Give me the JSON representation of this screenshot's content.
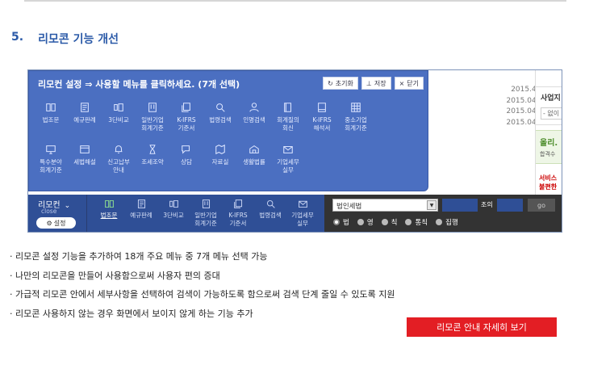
{
  "section": {
    "number": "5.",
    "title": "리모콘 기능 개선"
  },
  "background": {
    "dates": [
      "2015.4.14",
      "2015.04.16",
      "2015.04.16",
      "2015.04.16"
    ],
    "box1_title": "사업지",
    "box1_select": "- 없이",
    "box2_title": "올리.",
    "box2_sub": "합격수",
    "box3_text": [
      "서비스",
      "불편한"
    ]
  },
  "panel": {
    "title": "리모컨 설정 ⇒ 사용할 메뉴를 클릭하세요. (7개 선택)",
    "buttons": [
      "초기화",
      "저장",
      "닫기"
    ],
    "items": [
      {
        "label": "법조문"
      },
      {
        "label": "예규판례"
      },
      {
        "label": "3단비교"
      },
      {
        "label": "일반기업\n회계기준"
      },
      {
        "label": "K-IFRS\n기준서"
      },
      {
        "label": "법령검색"
      },
      {
        "label": "인명검색"
      },
      {
        "label": "회계질의\n회신"
      },
      {
        "label": "K-IFRS\n해석서"
      },
      {
        "label": "중소기업\n회계기준"
      },
      {
        "label": "특수분야\n회계기준"
      },
      {
        "label": "세법해설"
      },
      {
        "label": "신고납부\n안내"
      },
      {
        "label": "조세조약"
      },
      {
        "label": "상담"
      },
      {
        "label": "자료실"
      },
      {
        "label": "생활법률"
      },
      {
        "label": "기업세무\n실무"
      }
    ]
  },
  "bar": {
    "label": "리모컨",
    "close": "close",
    "settings": "설정",
    "items": [
      {
        "label": "법조문",
        "active": true
      },
      {
        "label": "예규판례"
      },
      {
        "label": "3단비교"
      },
      {
        "label": "일반기업\n회계기준"
      },
      {
        "label": "K-IFRS\n기준서"
      },
      {
        "label": "법령검색"
      },
      {
        "label": "기업세무\n실무"
      }
    ],
    "select_value": "법인세법",
    "search_label": "조의",
    "go": "go",
    "radios": [
      "법",
      "영",
      "칙",
      "통칙",
      "집행"
    ]
  },
  "bullets": [
    "· 리모콘 설정 기능을 추가하여 18개 주요 메뉴 중 7개 메뉴 선택 가능",
    "· 나만의 리모콘을 만들어 사용함으로써 사용자 편의 증대",
    "· 가급적 리모콘 안에서 세부사항을 선택하여 검색이 가능하도록 함으로써 검색 단계 줄일 수 있도록 지원",
    "· 리모콘 사용하지 않는 경우 화면에서 보이지 않게 하는 기능 추가"
  ],
  "cta": "리모콘 안내 자세히 보기"
}
